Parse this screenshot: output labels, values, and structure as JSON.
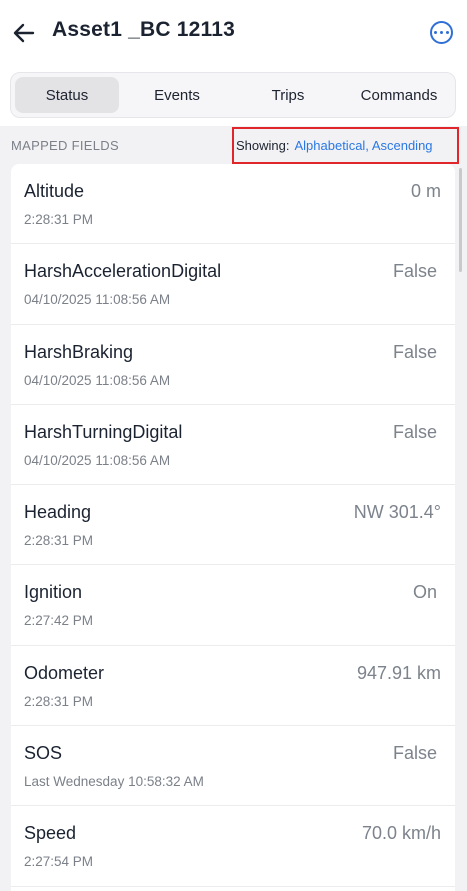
{
  "header": {
    "title": "Asset1 _BC 12113"
  },
  "tabs": [
    {
      "label": "Status",
      "active": true
    },
    {
      "label": "Events",
      "active": false
    },
    {
      "label": "Trips",
      "active": false
    },
    {
      "label": "Commands",
      "active": false
    }
  ],
  "section": {
    "label": "MAPPED FIELDS",
    "showing_label": "Showing:",
    "showing_value": "Alphabetical, Ascending"
  },
  "fields": [
    {
      "name": "Altitude",
      "time": "2:28:31 PM",
      "value": "0 m"
    },
    {
      "name": "HarshAccelerationDigital",
      "time": "04/10/2025 11:08:56 AM",
      "value": "False"
    },
    {
      "name": "HarshBraking",
      "time": "04/10/2025 11:08:56 AM",
      "value": "False"
    },
    {
      "name": "HarshTurningDigital",
      "time": "04/10/2025 11:08:56 AM",
      "value": "False"
    },
    {
      "name": "Heading",
      "time": "2:28:31 PM",
      "value": "NW 301.4°"
    },
    {
      "name": "Ignition",
      "time": "2:27:42 PM",
      "value": "On"
    },
    {
      "name": "Odometer",
      "time": "2:28:31 PM",
      "value": "947.91 km"
    },
    {
      "name": "SOS",
      "time": "Last Wednesday 10:58:32 AM",
      "value": "False"
    },
    {
      "name": "Speed",
      "time": "2:27:54 PM",
      "value": "70.0 km/h"
    }
  ],
  "colors": {
    "accent": "#2a78e4",
    "highlight_border": "#e0252b"
  },
  "icons": {
    "back": "arrow-left-icon",
    "more": "more-horizontal-icon"
  }
}
